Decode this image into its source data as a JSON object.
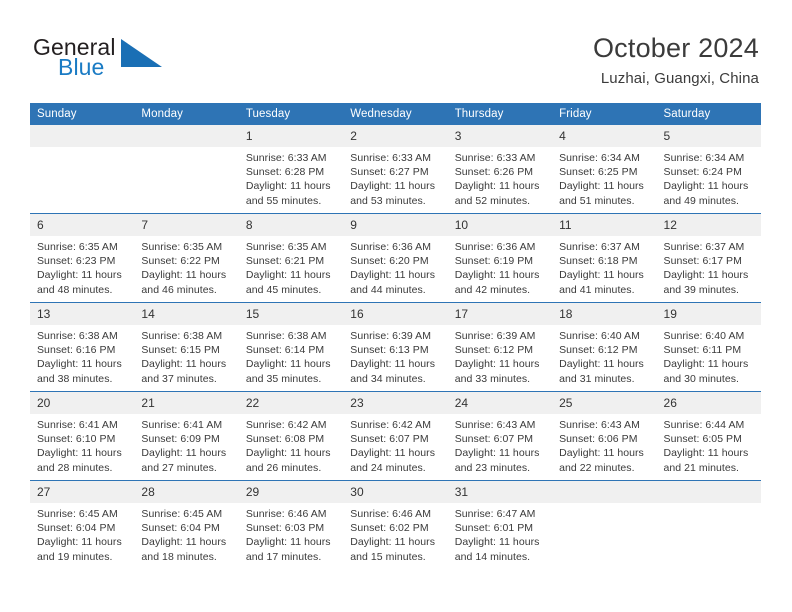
{
  "brand": {
    "word1": "General",
    "word2": "Blue",
    "logo_icon": "triangle-icon",
    "accent_color": "#1a7bc4"
  },
  "header": {
    "month_title": "October 2024",
    "location": "Luzhai, Guangxi, China"
  },
  "theme": {
    "header_blue": "#2e74b5",
    "daynum_band": "#f0f0f0",
    "text": "#3a3a3a"
  },
  "calendar": {
    "weekday_headers": [
      "Sunday",
      "Monday",
      "Tuesday",
      "Wednesday",
      "Thursday",
      "Friday",
      "Saturday"
    ],
    "weeks": [
      [
        {
          "day": "",
          "lines": []
        },
        {
          "day": "",
          "lines": []
        },
        {
          "day": "1",
          "lines": [
            "Sunrise: 6:33 AM",
            "Sunset: 6:28 PM",
            "Daylight: 11 hours",
            "and 55 minutes."
          ]
        },
        {
          "day": "2",
          "lines": [
            "Sunrise: 6:33 AM",
            "Sunset: 6:27 PM",
            "Daylight: 11 hours",
            "and 53 minutes."
          ]
        },
        {
          "day": "3",
          "lines": [
            "Sunrise: 6:33 AM",
            "Sunset: 6:26 PM",
            "Daylight: 11 hours",
            "and 52 minutes."
          ]
        },
        {
          "day": "4",
          "lines": [
            "Sunrise: 6:34 AM",
            "Sunset: 6:25 PM",
            "Daylight: 11 hours",
            "and 51 minutes."
          ]
        },
        {
          "day": "5",
          "lines": [
            "Sunrise: 6:34 AM",
            "Sunset: 6:24 PM",
            "Daylight: 11 hours",
            "and 49 minutes."
          ]
        }
      ],
      [
        {
          "day": "6",
          "lines": [
            "Sunrise: 6:35 AM",
            "Sunset: 6:23 PM",
            "Daylight: 11 hours",
            "and 48 minutes."
          ]
        },
        {
          "day": "7",
          "lines": [
            "Sunrise: 6:35 AM",
            "Sunset: 6:22 PM",
            "Daylight: 11 hours",
            "and 46 minutes."
          ]
        },
        {
          "day": "8",
          "lines": [
            "Sunrise: 6:35 AM",
            "Sunset: 6:21 PM",
            "Daylight: 11 hours",
            "and 45 minutes."
          ]
        },
        {
          "day": "9",
          "lines": [
            "Sunrise: 6:36 AM",
            "Sunset: 6:20 PM",
            "Daylight: 11 hours",
            "and 44 minutes."
          ]
        },
        {
          "day": "10",
          "lines": [
            "Sunrise: 6:36 AM",
            "Sunset: 6:19 PM",
            "Daylight: 11 hours",
            "and 42 minutes."
          ]
        },
        {
          "day": "11",
          "lines": [
            "Sunrise: 6:37 AM",
            "Sunset: 6:18 PM",
            "Daylight: 11 hours",
            "and 41 minutes."
          ]
        },
        {
          "day": "12",
          "lines": [
            "Sunrise: 6:37 AM",
            "Sunset: 6:17 PM",
            "Daylight: 11 hours",
            "and 39 minutes."
          ]
        }
      ],
      [
        {
          "day": "13",
          "lines": [
            "Sunrise: 6:38 AM",
            "Sunset: 6:16 PM",
            "Daylight: 11 hours",
            "and 38 minutes."
          ]
        },
        {
          "day": "14",
          "lines": [
            "Sunrise: 6:38 AM",
            "Sunset: 6:15 PM",
            "Daylight: 11 hours",
            "and 37 minutes."
          ]
        },
        {
          "day": "15",
          "lines": [
            "Sunrise: 6:38 AM",
            "Sunset: 6:14 PM",
            "Daylight: 11 hours",
            "and 35 minutes."
          ]
        },
        {
          "day": "16",
          "lines": [
            "Sunrise: 6:39 AM",
            "Sunset: 6:13 PM",
            "Daylight: 11 hours",
            "and 34 minutes."
          ]
        },
        {
          "day": "17",
          "lines": [
            "Sunrise: 6:39 AM",
            "Sunset: 6:12 PM",
            "Daylight: 11 hours",
            "and 33 minutes."
          ]
        },
        {
          "day": "18",
          "lines": [
            "Sunrise: 6:40 AM",
            "Sunset: 6:12 PM",
            "Daylight: 11 hours",
            "and 31 minutes."
          ]
        },
        {
          "day": "19",
          "lines": [
            "Sunrise: 6:40 AM",
            "Sunset: 6:11 PM",
            "Daylight: 11 hours",
            "and 30 minutes."
          ]
        }
      ],
      [
        {
          "day": "20",
          "lines": [
            "Sunrise: 6:41 AM",
            "Sunset: 6:10 PM",
            "Daylight: 11 hours",
            "and 28 minutes."
          ]
        },
        {
          "day": "21",
          "lines": [
            "Sunrise: 6:41 AM",
            "Sunset: 6:09 PM",
            "Daylight: 11 hours",
            "and 27 minutes."
          ]
        },
        {
          "day": "22",
          "lines": [
            "Sunrise: 6:42 AM",
            "Sunset: 6:08 PM",
            "Daylight: 11 hours",
            "and 26 minutes."
          ]
        },
        {
          "day": "23",
          "lines": [
            "Sunrise: 6:42 AM",
            "Sunset: 6:07 PM",
            "Daylight: 11 hours",
            "and 24 minutes."
          ]
        },
        {
          "day": "24",
          "lines": [
            "Sunrise: 6:43 AM",
            "Sunset: 6:07 PM",
            "Daylight: 11 hours",
            "and 23 minutes."
          ]
        },
        {
          "day": "25",
          "lines": [
            "Sunrise: 6:43 AM",
            "Sunset: 6:06 PM",
            "Daylight: 11 hours",
            "and 22 minutes."
          ]
        },
        {
          "day": "26",
          "lines": [
            "Sunrise: 6:44 AM",
            "Sunset: 6:05 PM",
            "Daylight: 11 hours",
            "and 21 minutes."
          ]
        }
      ],
      [
        {
          "day": "27",
          "lines": [
            "Sunrise: 6:45 AM",
            "Sunset: 6:04 PM",
            "Daylight: 11 hours",
            "and 19 minutes."
          ]
        },
        {
          "day": "28",
          "lines": [
            "Sunrise: 6:45 AM",
            "Sunset: 6:04 PM",
            "Daylight: 11 hours",
            "and 18 minutes."
          ]
        },
        {
          "day": "29",
          "lines": [
            "Sunrise: 6:46 AM",
            "Sunset: 6:03 PM",
            "Daylight: 11 hours",
            "and 17 minutes."
          ]
        },
        {
          "day": "30",
          "lines": [
            "Sunrise: 6:46 AM",
            "Sunset: 6:02 PM",
            "Daylight: 11 hours",
            "and 15 minutes."
          ]
        },
        {
          "day": "31",
          "lines": [
            "Sunrise: 6:47 AM",
            "Sunset: 6:01 PM",
            "Daylight: 11 hours",
            "and 14 minutes."
          ]
        },
        {
          "day": "",
          "lines": []
        },
        {
          "day": "",
          "lines": []
        }
      ]
    ]
  }
}
